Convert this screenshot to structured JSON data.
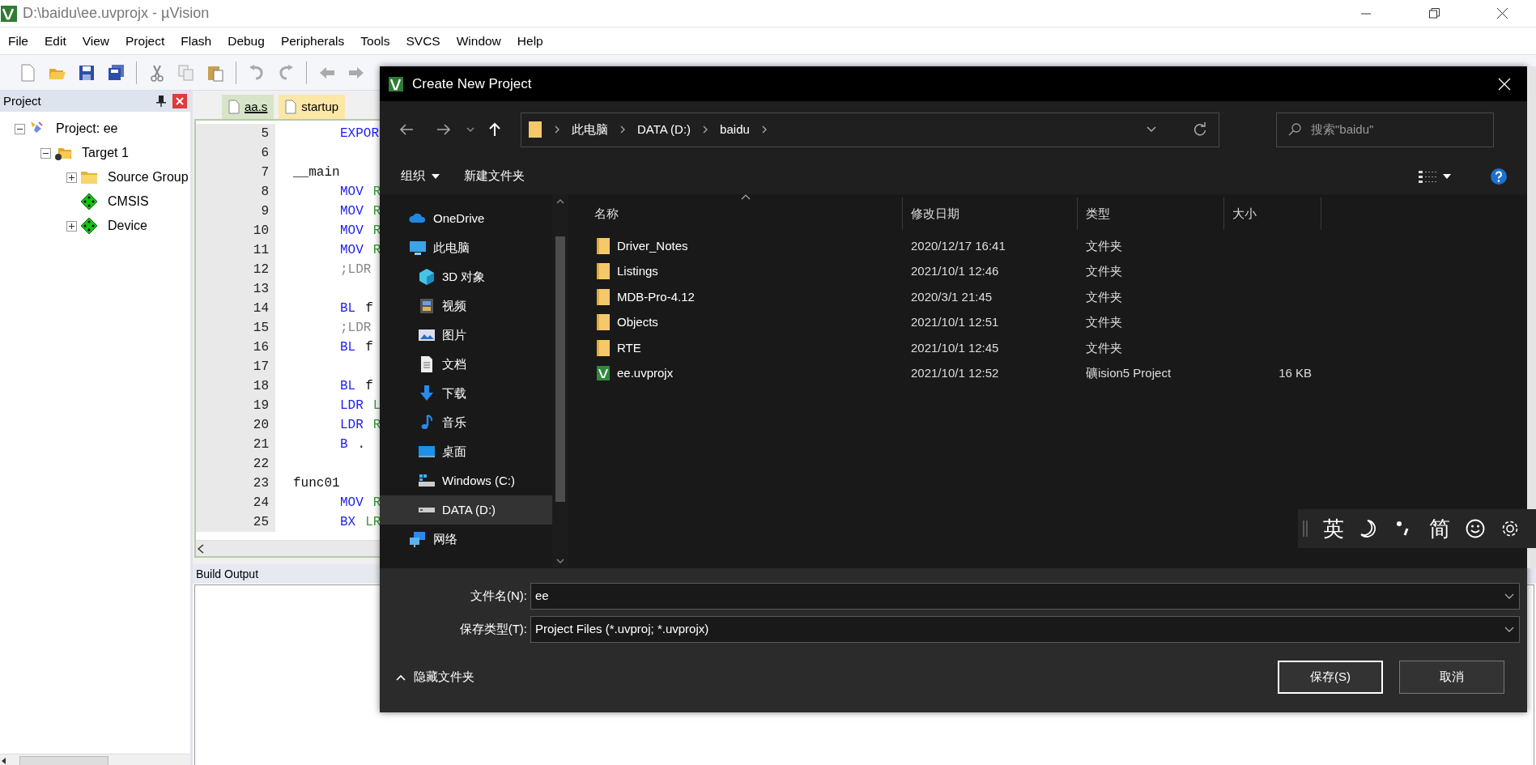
{
  "window": {
    "title": "D:\\baidu\\ee.uvprojx - µVision"
  },
  "menu": [
    "File",
    "Edit",
    "View",
    "Project",
    "Flash",
    "Debug",
    "Peripherals",
    "Tools",
    "SVCS",
    "Window",
    "Help"
  ],
  "project_panel": {
    "title": "Project",
    "tree": [
      {
        "label": "Project: ee",
        "kind": "project",
        "expanded": true,
        "children": [
          {
            "label": "Target 1",
            "kind": "target",
            "expanded": true,
            "children": [
              {
                "label": "Source Group",
                "kind": "folder",
                "expanded": false
              },
              {
                "label": "CMSIS",
                "kind": "component"
              },
              {
                "label": "Device",
                "kind": "component",
                "expanded": false
              }
            ]
          }
        ]
      }
    ]
  },
  "editor": {
    "tabs": [
      {
        "label": "aa.s",
        "selected": true
      },
      {
        "label": "startup",
        "selected": false
      }
    ],
    "lines": [
      {
        "number": "5",
        "code": [
          {
            "kind": "instr",
            "text": "EXPOR"
          }
        ]
      },
      {
        "number": "6"
      },
      {
        "number": "7",
        "code": [
          {
            "kind": "label",
            "text": "__main"
          }
        ]
      },
      {
        "number": "8",
        "code": [
          {
            "kind": "instr",
            "text": "MOV"
          },
          {
            "kind": "operand",
            "text": "R"
          }
        ]
      },
      {
        "number": "9",
        "code": [
          {
            "kind": "instr",
            "text": "MOV"
          },
          {
            "kind": "operand",
            "text": "R"
          }
        ]
      },
      {
        "number": "10",
        "code": [
          {
            "kind": "instr",
            "text": "MOV"
          },
          {
            "kind": "operand",
            "text": "R"
          }
        ]
      },
      {
        "number": "11",
        "code": [
          {
            "kind": "instr",
            "text": "MOV"
          },
          {
            "kind": "operand",
            "text": "R"
          }
        ]
      },
      {
        "number": "12",
        "code": [
          {
            "kind": "comment",
            "text": ";LDR"
          }
        ]
      },
      {
        "number": "13"
      },
      {
        "number": "14",
        "code": [
          {
            "kind": "instr",
            "text": "BL"
          },
          {
            "kind": "plain",
            "text": "f"
          }
        ]
      },
      {
        "number": "15",
        "code": [
          {
            "kind": "comment",
            "text": ";LDR"
          }
        ]
      },
      {
        "number": "16",
        "code": [
          {
            "kind": "instr",
            "text": "BL"
          },
          {
            "kind": "plain",
            "text": "f"
          }
        ]
      },
      {
        "number": "17"
      },
      {
        "number": "18",
        "code": [
          {
            "kind": "instr",
            "text": "BL"
          },
          {
            "kind": "plain",
            "text": "f"
          }
        ]
      },
      {
        "number": "19",
        "code": [
          {
            "kind": "instr",
            "text": "LDR"
          },
          {
            "kind": "operand",
            "text": "L"
          }
        ]
      },
      {
        "number": "20",
        "code": [
          {
            "kind": "instr",
            "text": "LDR"
          },
          {
            "kind": "operand",
            "text": "R"
          }
        ]
      },
      {
        "number": "21",
        "code": [
          {
            "kind": "instr",
            "text": "B"
          },
          {
            "kind": "plain",
            "text": "."
          }
        ]
      },
      {
        "number": "22"
      },
      {
        "number": "23",
        "code": [
          {
            "kind": "label",
            "text": "func01"
          }
        ]
      },
      {
        "number": "24",
        "code": [
          {
            "kind": "instr",
            "text": "MOV"
          },
          {
            "kind": "operand",
            "text": "R"
          }
        ]
      },
      {
        "number": "25",
        "code": [
          {
            "kind": "instr",
            "text": "BX"
          },
          {
            "kind": "operand",
            "text": "LR"
          }
        ]
      }
    ]
  },
  "build_output": {
    "title": "Build Output"
  },
  "dialog": {
    "title": "Create New Project",
    "path": [
      "此电脑",
      "DATA (D:)",
      "baidu"
    ],
    "search": {
      "placeholder": "搜索\"baidu\""
    },
    "commands": [
      {
        "label": "组织",
        "dropdown": true
      },
      {
        "label": "新建文件夹",
        "dropdown": false
      }
    ],
    "nav": [
      {
        "label": "OneDrive",
        "kind": "cloud",
        "selected": false
      },
      {
        "label": "此电脑",
        "kind": "computer",
        "selected": false,
        "children": [
          {
            "label": "3D 对象",
            "kind": "cube",
            "selected": false
          },
          {
            "label": "视频",
            "kind": "video",
            "selected": false
          },
          {
            "label": "图片",
            "kind": "pictures",
            "selected": false
          },
          {
            "label": "文档",
            "kind": "documents",
            "selected": false
          },
          {
            "label": "下载",
            "kind": "downloads",
            "selected": false
          },
          {
            "label": "音乐",
            "kind": "music",
            "selected": false
          },
          {
            "label": "桌面",
            "kind": "desktop",
            "selected": false
          },
          {
            "label": "Windows (C:)",
            "kind": "system_drive",
            "selected": false
          },
          {
            "label": "DATA (D:)",
            "kind": "drive",
            "selected": true
          }
        ]
      },
      {
        "label": "网络",
        "kind": "network",
        "selected": false
      }
    ],
    "columns": [
      "名称",
      "修改日期",
      "类型",
      "大小"
    ],
    "files": [
      {
        "name": "Driver_Notes",
        "kind": "folder",
        "date": "2020/12/17 16:41",
        "type": "文件夹"
      },
      {
        "name": "Listings",
        "kind": "folder",
        "date": "2021/10/1 12:46",
        "type": "文件夹"
      },
      {
        "name": "MDB-Pro-4.12",
        "kind": "folder",
        "date": "2020/3/1 21:45",
        "type": "文件夹"
      },
      {
        "name": "Objects",
        "kind": "folder",
        "date": "2021/10/1 12:51",
        "type": "文件夹"
      },
      {
        "name": "RTE",
        "kind": "folder",
        "date": "2021/10/1 12:45",
        "type": "文件夹"
      },
      {
        "name": "ee.uvprojx",
        "kind": "project",
        "date": "2021/10/1 12:52",
        "type": "礦ision5 Project",
        "size": "16 KB"
      }
    ],
    "file_name": {
      "label": "文件名(N):",
      "value": "ee"
    },
    "save_type": {
      "label": "保存类型(T):",
      "value": "Project Files (*.uvproj; *.uvprojx)"
    },
    "hide_folders": "隐藏文件夹",
    "buttons": [
      {
        "label": "保存(S)",
        "default": true
      },
      {
        "label": "取消",
        "default": false
      }
    ]
  },
  "ime_bar": {
    "items": [
      {
        "kind": "text",
        "text": "英"
      },
      {
        "kind": "moon"
      },
      {
        "kind": "punctuation"
      },
      {
        "kind": "text",
        "text": "简"
      },
      {
        "kind": "smiley"
      },
      {
        "kind": "gear"
      }
    ]
  }
}
